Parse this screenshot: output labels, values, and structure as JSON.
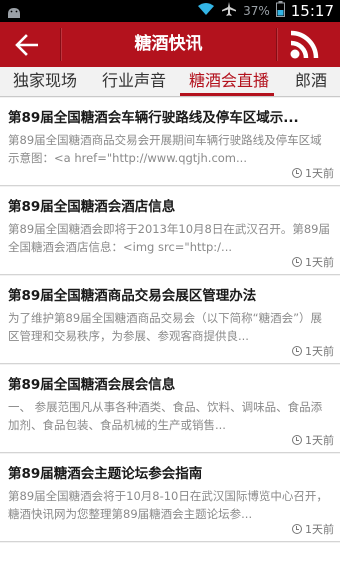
{
  "status_bar": {
    "battery_percent": "37%",
    "time": "15:17",
    "icons": [
      "android-icon",
      "wifi-icon",
      "airplane-icon",
      "battery-icon"
    ]
  },
  "header": {
    "title": "糖酒快讯",
    "back_icon": "back-arrow-icon",
    "rss_icon": "rss-icon",
    "color": "#b3121d"
  },
  "tabs": [
    {
      "label": "独家现场",
      "active": false
    },
    {
      "label": "行业声音",
      "active": false
    },
    {
      "label": "糖酒会直播",
      "active": true
    },
    {
      "label": "郎酒",
      "active": false
    }
  ],
  "articles": [
    {
      "title": "第89届全国糖酒会车辆行驶路线及停车区域示...",
      "summary": "第89届全国糖酒商品交易会开展期间车辆行驶路线及停车区域示意图：<a href=\"http://www.qgtjh.com...",
      "time": "1天前"
    },
    {
      "title": "第89届全国糖酒会酒店信息",
      "summary": "第89届全国糖酒会即将于2013年10月8日在武汉召开。第89届全国糖酒会酒店信息：<img src=\"http:/...",
      "time": "1天前"
    },
    {
      "title": "第89届全国糖酒商品交易会展区管理办法",
      "summary": "为了维护第89届全国糖酒商品交易会（以下简称“糖酒会”）展区管理和交易秩序，为参展、参观客商提供良...",
      "time": "1天前"
    },
    {
      "title": "第89届全国糖酒会展会信息",
      "summary": "一、 参展范围凡从事各种酒类、食品、饮料、调味品、食品添加剂、食品包装、食品机械的生产或销售...",
      "time": "1天前"
    },
    {
      "title": "第89届糖酒会主题论坛参会指南",
      "summary": "第89届全国糖酒会将于10月8-10日在武汉国际博览中心召开，糖酒快讯网为您整理第89届糖酒会主题论坛参...",
      "time": "1天前"
    }
  ]
}
